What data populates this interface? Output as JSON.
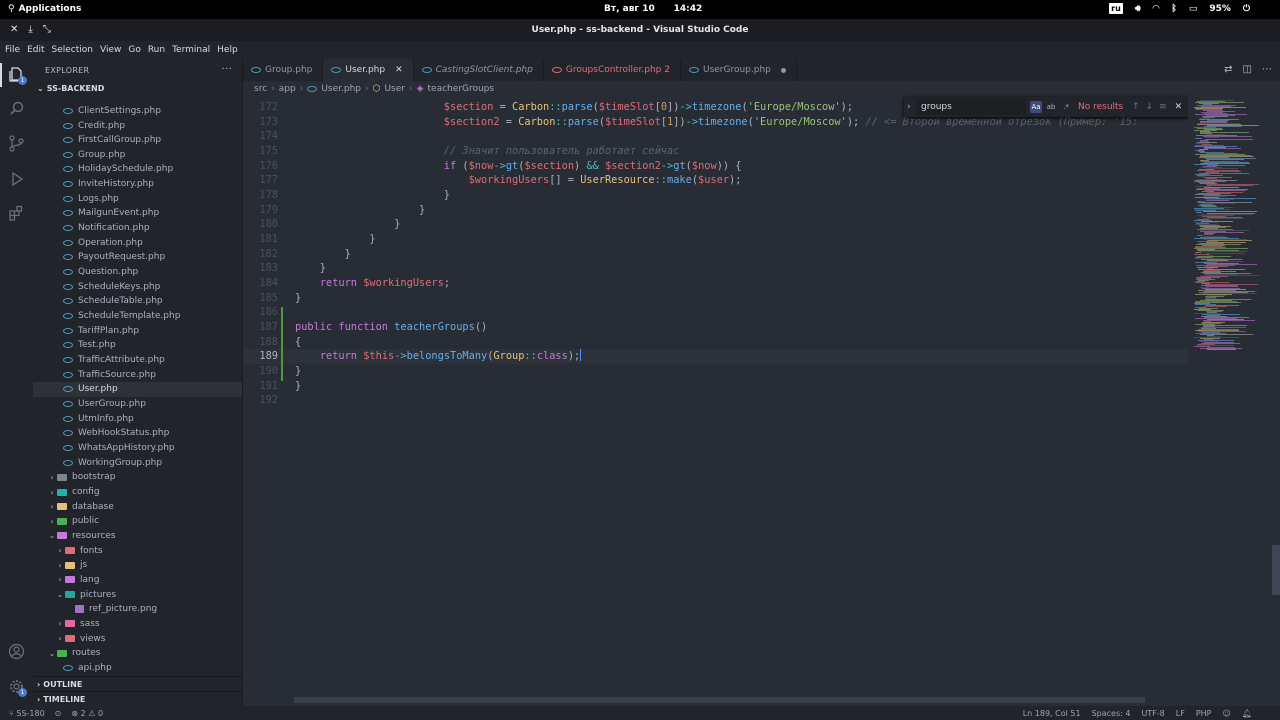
{
  "system_bar": {
    "activities": "Applications",
    "date": "Вт, авг 10",
    "time": "14:42",
    "keyboard_layout": "ru",
    "battery": "95%"
  },
  "window": {
    "title": "User.php - ss-backend - Visual Studio Code"
  },
  "menu": [
    "File",
    "Edit",
    "Selection",
    "View",
    "Go",
    "Run",
    "Terminal",
    "Help"
  ],
  "activity_bar": {
    "explorer_badge": "1",
    "settings_badge": "1"
  },
  "sidebar": {
    "header": "EXPLORER",
    "more": "···",
    "project": "SS-BACKEND",
    "tree": [
      {
        "label": "ClientSettings.php",
        "type": "php",
        "depth": 2
      },
      {
        "label": "Credit.php",
        "type": "php",
        "depth": 2
      },
      {
        "label": "FirstCallGroup.php",
        "type": "php",
        "depth": 2
      },
      {
        "label": "Group.php",
        "type": "php",
        "depth": 2
      },
      {
        "label": "HolidaySchedule.php",
        "type": "php",
        "depth": 2
      },
      {
        "label": "InviteHistory.php",
        "type": "php",
        "depth": 2
      },
      {
        "label": "Logs.php",
        "type": "php",
        "depth": 2
      },
      {
        "label": "MailgunEvent.php",
        "type": "php",
        "depth": 2
      },
      {
        "label": "Notification.php",
        "type": "php",
        "depth": 2
      },
      {
        "label": "Operation.php",
        "type": "php",
        "depth": 2
      },
      {
        "label": "PayoutRequest.php",
        "type": "php",
        "depth": 2
      },
      {
        "label": "Question.php",
        "type": "php",
        "depth": 2
      },
      {
        "label": "ScheduleKeys.php",
        "type": "php",
        "depth": 2
      },
      {
        "label": "ScheduleTable.php",
        "type": "php",
        "depth": 2
      },
      {
        "label": "ScheduleTemplate.php",
        "type": "php",
        "depth": 2
      },
      {
        "label": "TariffPlan.php",
        "type": "php",
        "depth": 2
      },
      {
        "label": "Test.php",
        "type": "php",
        "depth": 2
      },
      {
        "label": "TrafficAttribute.php",
        "type": "php",
        "depth": 2
      },
      {
        "label": "TrafficSource.php",
        "type": "php",
        "depth": 2
      },
      {
        "label": "User.php",
        "type": "php",
        "depth": 2,
        "selected": true
      },
      {
        "label": "UserGroup.php",
        "type": "php",
        "depth": 2
      },
      {
        "label": "UtmInfo.php",
        "type": "php",
        "depth": 2
      },
      {
        "label": "WebHookStatus.php",
        "type": "php",
        "depth": 2
      },
      {
        "label": "WhatsAppHistory.php",
        "type": "php",
        "depth": 2
      },
      {
        "label": "WorkingGroup.php",
        "type": "php",
        "depth": 2
      },
      {
        "label": "bootstrap",
        "type": "folder",
        "depth": 1,
        "open": false,
        "color": "#7b8594"
      },
      {
        "label": "config",
        "type": "folder",
        "depth": 1,
        "open": false,
        "color": "#20b2aa"
      },
      {
        "label": "database",
        "type": "folder",
        "depth": 1,
        "open": false,
        "color": "#e5c07b"
      },
      {
        "label": "public",
        "type": "folder",
        "depth": 1,
        "open": false,
        "color": "#4caf50"
      },
      {
        "label": "resources",
        "type": "folder",
        "depth": 1,
        "open": true,
        "color": "#c678dd"
      },
      {
        "label": "fonts",
        "type": "folder",
        "depth": 2,
        "open": false,
        "color": "#e06c75"
      },
      {
        "label": "js",
        "type": "folder",
        "depth": 2,
        "open": false,
        "color": "#e5c07b"
      },
      {
        "label": "lang",
        "type": "folder",
        "depth": 2,
        "open": false,
        "color": "#c678dd"
      },
      {
        "label": "pictures",
        "type": "folder",
        "depth": 2,
        "open": true,
        "color": "#26a69a"
      },
      {
        "label": "ref_picture.png",
        "type": "image",
        "depth": 3
      },
      {
        "label": "sass",
        "type": "folder",
        "depth": 2,
        "open": false,
        "color": "#e06c9f"
      },
      {
        "label": "views",
        "type": "folder",
        "depth": 2,
        "open": false,
        "color": "#e06c75"
      },
      {
        "label": "routes",
        "type": "folder",
        "depth": 1,
        "open": true,
        "color": "#4caf50"
      },
      {
        "label": "api.php",
        "type": "php",
        "depth": 2
      }
    ],
    "outline": "OUTLINE",
    "timeline": "TIMELINE"
  },
  "tabs": [
    {
      "label": "Group.php",
      "state": "normal"
    },
    {
      "label": "User.php",
      "state": "active"
    },
    {
      "label": "CastingSlotClient.php",
      "state": "preview"
    },
    {
      "label": "GroupsController.php 2",
      "state": "error"
    },
    {
      "label": "UserGroup.php",
      "state": "dirty"
    }
  ],
  "breadcrumb": [
    "src",
    "app",
    "User.php",
    "User",
    "teacherGroups"
  ],
  "find": {
    "query": "groups",
    "status": "No results",
    "match_case": "Aa",
    "whole_word": "ab",
    "regex": ".*"
  },
  "editor": {
    "current_line": 189,
    "lines": [
      {
        "n": "172",
        "code": [
          [
            "pl",
            "                        "
          ],
          [
            "var",
            "$section"
          ],
          [
            "pl",
            " = "
          ],
          [
            "cls",
            "Carbon"
          ],
          [
            "op",
            "::"
          ],
          [
            "fn",
            "parse"
          ],
          [
            "pl",
            "("
          ],
          [
            "var",
            "$timeSlot"
          ],
          [
            "pl",
            "["
          ],
          [
            "num",
            "0"
          ],
          [
            "pl",
            "])"
          ],
          [
            "op",
            "->"
          ],
          [
            "fn",
            "timezone"
          ],
          [
            "pl",
            "("
          ],
          [
            "str",
            "'Europe/Moscow'"
          ],
          [
            "pl",
            ");"
          ]
        ]
      },
      {
        "n": "173",
        "code": [
          [
            "pl",
            "                        "
          ],
          [
            "var",
            "$section2"
          ],
          [
            "pl",
            " = "
          ],
          [
            "cls",
            "Carbon"
          ],
          [
            "op",
            "::"
          ],
          [
            "fn",
            "parse"
          ],
          [
            "pl",
            "("
          ],
          [
            "var",
            "$timeSlot"
          ],
          [
            "pl",
            "["
          ],
          [
            "num",
            "1"
          ],
          [
            "pl",
            "])"
          ],
          [
            "op",
            "->"
          ],
          [
            "fn",
            "timezone"
          ],
          [
            "pl",
            "("
          ],
          [
            "str",
            "'Europe/Moscow'"
          ],
          [
            "pl",
            "); "
          ],
          [
            "cmt",
            "// <= Второй временной отрезок (Пример: '15:"
          ]
        ]
      },
      {
        "n": "174",
        "code": []
      },
      {
        "n": "175",
        "code": [
          [
            "pl",
            "                        "
          ],
          [
            "cmt",
            "// Значит пользователь работает сейчас"
          ]
        ]
      },
      {
        "n": "176",
        "code": [
          [
            "pl",
            "                        "
          ],
          [
            "kw",
            "if"
          ],
          [
            "pl",
            " ("
          ],
          [
            "var",
            "$now"
          ],
          [
            "op",
            "->"
          ],
          [
            "fn",
            "gt"
          ],
          [
            "pl",
            "("
          ],
          [
            "var",
            "$section"
          ],
          [
            "pl",
            ") "
          ],
          [
            "op",
            "&&"
          ],
          [
            "pl",
            " "
          ],
          [
            "var",
            "$section2"
          ],
          [
            "op",
            "->"
          ],
          [
            "fn",
            "gt"
          ],
          [
            "pl",
            "("
          ],
          [
            "var",
            "$now"
          ],
          [
            "pl",
            ")) {"
          ]
        ]
      },
      {
        "n": "177",
        "code": [
          [
            "pl",
            "                            "
          ],
          [
            "var",
            "$workingUsers"
          ],
          [
            "pl",
            "[] = "
          ],
          [
            "cls",
            "UserResource"
          ],
          [
            "op",
            "::"
          ],
          [
            "fn",
            "make"
          ],
          [
            "pl",
            "("
          ],
          [
            "var",
            "$user"
          ],
          [
            "pl",
            ");"
          ]
        ]
      },
      {
        "n": "178",
        "code": [
          [
            "pl",
            "                        }"
          ]
        ]
      },
      {
        "n": "179",
        "code": [
          [
            "pl",
            "                    }"
          ]
        ]
      },
      {
        "n": "180",
        "code": [
          [
            "pl",
            "                }"
          ]
        ]
      },
      {
        "n": "181",
        "code": [
          [
            "pl",
            "            }"
          ]
        ]
      },
      {
        "n": "182",
        "code": [
          [
            "pl",
            "        }"
          ]
        ]
      },
      {
        "n": "183",
        "code": [
          [
            "pl",
            "    }"
          ]
        ]
      },
      {
        "n": "184",
        "code": [
          [
            "pl",
            "    "
          ],
          [
            "kw",
            "return"
          ],
          [
            "pl",
            " "
          ],
          [
            "var",
            "$workingUsers"
          ],
          [
            "pl",
            ";"
          ]
        ]
      },
      {
        "n": "185",
        "code": [
          [
            "pl",
            "}"
          ]
        ]
      },
      {
        "n": "186",
        "code": []
      },
      {
        "n": "187",
        "code": [
          [
            "kw",
            "public"
          ],
          [
            "pl",
            " "
          ],
          [
            "kw",
            "function"
          ],
          [
            "pl",
            " "
          ],
          [
            "fn",
            "teacherGroups"
          ],
          [
            "pl",
            "()"
          ]
        ]
      },
      {
        "n": "188",
        "code": [
          [
            "pl",
            "{"
          ]
        ]
      },
      {
        "n": "189",
        "code": [
          [
            "pl",
            "    "
          ],
          [
            "kw",
            "return"
          ],
          [
            "pl",
            " "
          ],
          [
            "var",
            "$this"
          ],
          [
            "op",
            "->"
          ],
          [
            "fn",
            "belongsToMany"
          ],
          [
            "pl",
            "("
          ],
          [
            "cls",
            "Group"
          ],
          [
            "op",
            "::"
          ],
          [
            "kw",
            "class"
          ],
          [
            "pl",
            ");"
          ]
        ]
      },
      {
        "n": "190",
        "code": [
          [
            "pl",
            "}"
          ]
        ]
      },
      {
        "n": "191",
        "code": [
          [
            "pl",
            "}"
          ]
        ]
      },
      {
        "n": "192",
        "code": []
      }
    ]
  },
  "status_bar": {
    "branch": "SS-180",
    "errors": "2",
    "warnings": "0",
    "position": "Ln 189, Col 51",
    "spaces": "Spaces: 4",
    "encoding": "UTF-8",
    "eol": "LF",
    "language": "PHP"
  }
}
